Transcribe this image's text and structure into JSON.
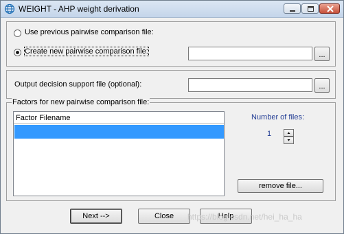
{
  "window": {
    "title": "WEIGHT - AHP weight derivation",
    "icons": {
      "app": "globe-icon",
      "minimize": "minimize-icon",
      "maximize": "maximize-icon",
      "close": "close-icon"
    }
  },
  "pairwise": {
    "option_previous_label": "Use previous pairwise comparison file:",
    "option_new_label": "Create new pairwise comparison file:",
    "selected_option": "new",
    "file_value": "",
    "browse_label": "..."
  },
  "output": {
    "label": "Output decision support file (optional):",
    "file_value": "",
    "browse_label": "..."
  },
  "factors": {
    "group_label": "Factors for new pairwise comparison file:",
    "list_header": "Factor Filename",
    "rows": [
      ""
    ],
    "number_of_files_label": "Number of files:",
    "number_of_files_value": "1",
    "remove_button_label": "remove file..."
  },
  "actions": {
    "next_label": "Next -->",
    "close_label": "Close",
    "help_label": "Help"
  },
  "watermark": "https://blog.csdn.net/hei_ha_ha",
  "colors": {
    "selection": "#3399ff",
    "dialog_bg": "#f0f0f0",
    "spin_value": "#1f3a93"
  }
}
